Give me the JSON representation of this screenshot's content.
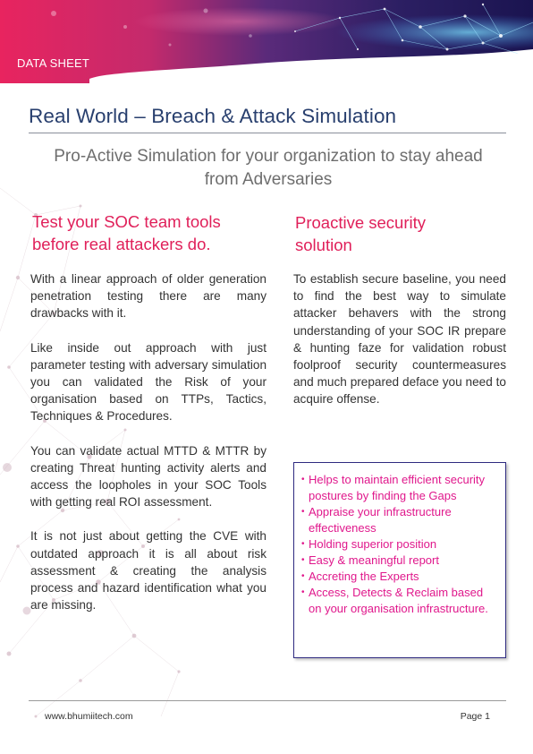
{
  "header": {
    "doc_type": "DATA SHEET"
  },
  "title": "Real World – Breach & Attack Simulation",
  "subtitle": "Pro-Active Simulation for your organization to stay ahead from Adversaries",
  "left_column": {
    "heading_line1": "Test your SOC team tools",
    "heading_line2": "before real attackers do.",
    "paragraphs": [
      "With a linear approach of older generation penetration testing there are many drawbacks with it.",
      "Like inside out approach with just parameter testing with adversary simulation you can validated the Risk of your organisation based on TTPs, Tactics, Techniques & Procedures.",
      "You can validate actual MTTD & MTTR by creating Threat hunting activity alerts and access the loopholes in your SOC Tools with getting real ROI assessment.",
      "It is not just about getting the CVE with outdated approach it is all about risk assessment & creating the analysis process and hazard identification what you are missing."
    ]
  },
  "right_column": {
    "heading_line1": "Proactive security",
    "heading_line2": "solution",
    "paragraph": "To establish secure baseline, you need to find the best way to simulate attacker behavers with the strong understanding of your SOC IR prepare & hunting faze for validation robust foolproof security countermeasures and much prepared deface you need to acquire offense.",
    "bullets": [
      "Helps to maintain efficient security postures by finding the Gaps",
      "Appraise your infrastructure effectiveness",
      "Holding superior position",
      "Easy & meaningful report",
      "Accreting the Experts",
      "Access, Detects & Reclaim based on your organisation infrastructure."
    ]
  },
  "footer": {
    "url": "www.bhumiitech.com",
    "page": "Page 1"
  },
  "colors": {
    "title": "#283f6e",
    "heading": "#e0205a",
    "bullet_text": "#e0188c",
    "box_border": "#2e2a80"
  }
}
